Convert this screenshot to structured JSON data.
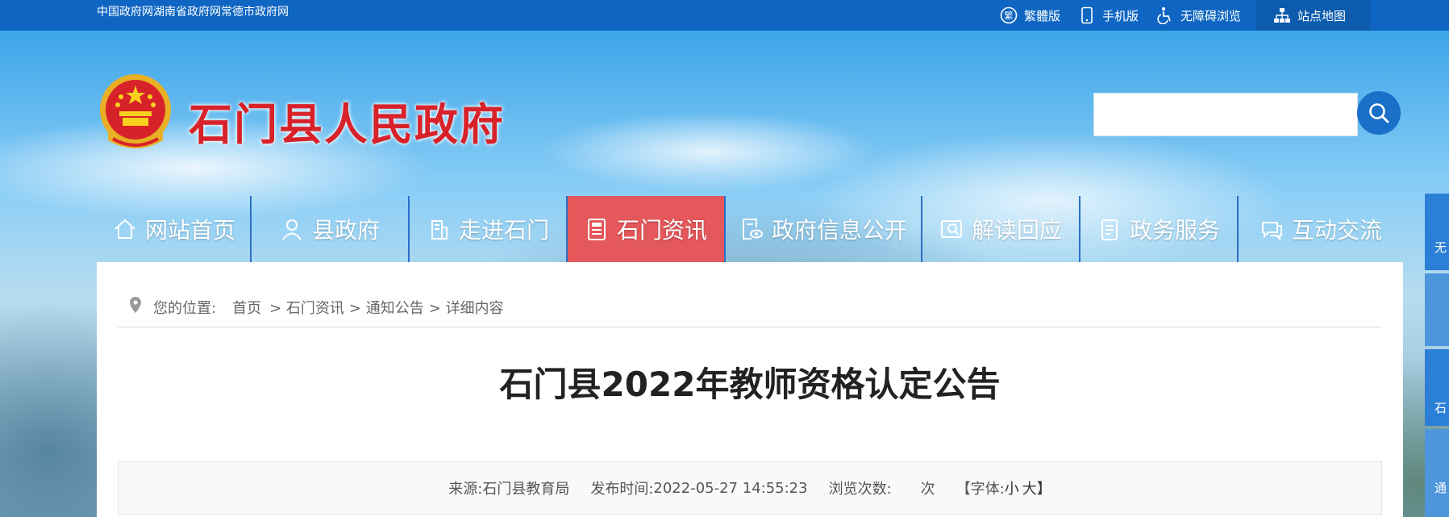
{
  "topbar": {
    "links": "中国政府网湖南省政府网常德市政府网",
    "tools": [
      {
        "icon": "traditional-chinese-icon",
        "label": "繁體版"
      },
      {
        "icon": "mobile-phone-icon",
        "label": "手机版"
      },
      {
        "icon": "wheelchair-icon",
        "label": "无障碍浏览"
      },
      {
        "icon": "sitemap-icon",
        "label": "站点地图"
      }
    ]
  },
  "header": {
    "site_title": "石门县人民政府",
    "search_placeholder": ""
  },
  "nav": [
    {
      "icon": "home-icon",
      "label": "网站首页",
      "active": false
    },
    {
      "icon": "person-icon",
      "label": "县政府",
      "active": false
    },
    {
      "icon": "building-icon",
      "label": "走进石门",
      "active": false
    },
    {
      "icon": "news-icon",
      "label": "石门资讯",
      "active": true
    },
    {
      "icon": "document-eye-icon",
      "label": "政府信息公开",
      "active": false
    },
    {
      "icon": "interpret-icon",
      "label": "解读回应",
      "active": false
    },
    {
      "icon": "clipboard-icon",
      "label": "政务服务",
      "active": false
    },
    {
      "icon": "chat-icon",
      "label": "互动交流",
      "active": false
    }
  ],
  "breadcrumb": {
    "prefix": "您的位置:",
    "items": [
      "首页",
      "> 石门资讯",
      "> 通知公告",
      "> 详细内容"
    ]
  },
  "article": {
    "title": "石门县2022年教师资格认定公告",
    "source_label": "来源:",
    "source": "石门县教育局",
    "time_label": "发布时间:",
    "time": "2022-05-27 14:55:23",
    "views_label": "浏览次数:",
    "views_unit": "次",
    "font_label": "【字体:",
    "font_small": "小",
    "font_large": "大】"
  },
  "side_tabs": [
    "无",
    "石",
    "通"
  ],
  "colors": {
    "topbar": "#0f66c2",
    "title_red": "#d8222a",
    "nav_active": "#e4575a",
    "search_button": "#1a6fc9"
  }
}
